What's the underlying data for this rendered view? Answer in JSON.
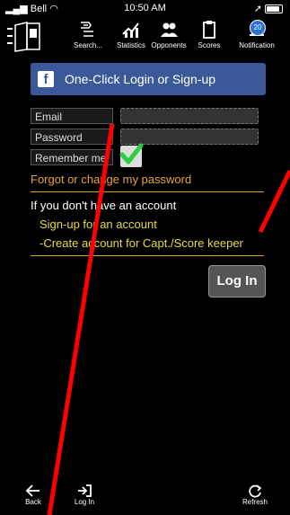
{
  "status_bar": {
    "carrier": "Bell",
    "time": "10:50 AM"
  },
  "toolbar": {
    "items": [
      {
        "label": "Search..."
      },
      {
        "label": "Statistics"
      },
      {
        "label": "Opponents"
      },
      {
        "label": "Scores"
      },
      {
        "label": "Notification",
        "badge": "20"
      }
    ]
  },
  "login": {
    "facebook_label": "One-Click Login or Sign-up",
    "email_label": "Email",
    "password_label": "Password",
    "remember_label": "Remember me",
    "remember_checked": true,
    "forgot_label": "Forgot or change my password",
    "no_account_label": "If you don't have an account",
    "signup_label": "Sign-up for an account",
    "create_captain_label": "-Create account for Capt./Score keeper",
    "login_button": "Log In"
  },
  "bottom_bar": {
    "back": "Back",
    "login": "Log In",
    "refresh": "Refresh"
  },
  "colors": {
    "facebook": "#3b5998",
    "forgot": "#e8a33c",
    "link": "#e6d94a",
    "divider": "#d4a017",
    "check": "#2ecc40",
    "annotation": "#ff0000"
  }
}
